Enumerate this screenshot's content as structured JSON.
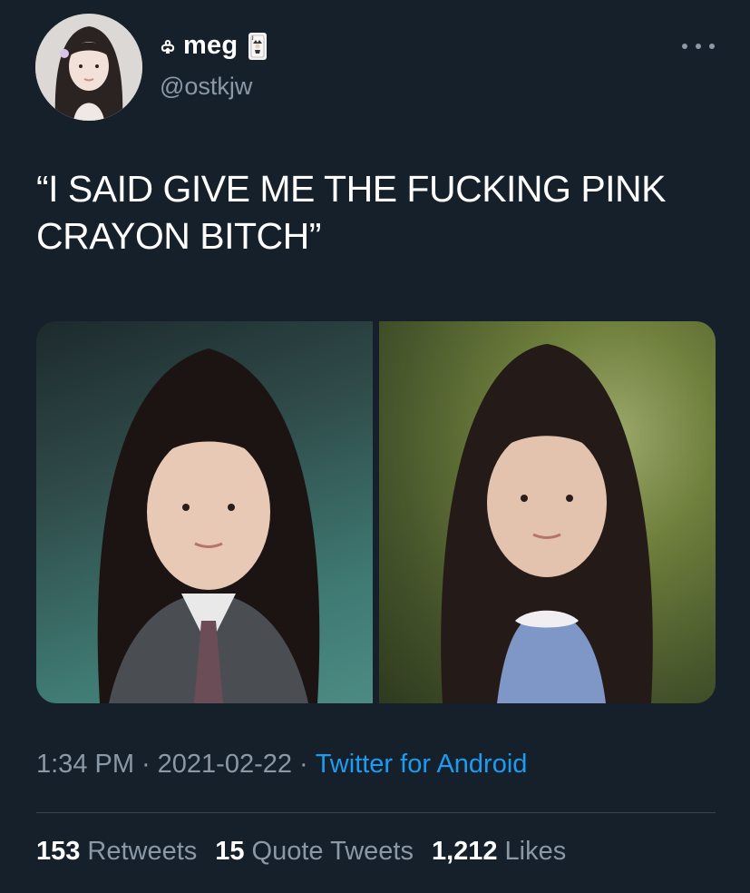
{
  "user": {
    "display_name": "meg",
    "handle": "@ostkjw",
    "name_prefix_icon": "club-outline-icon",
    "name_suffix_icon": "joker-card-icon"
  },
  "tweet": {
    "text": "“I SAID GIVE ME THE FUCKING PINK\nCRAYON BITCH”"
  },
  "media": {
    "left_photo": "portrait-photo-school-uniform",
    "right_photo": "portrait-photo-outdoor"
  },
  "meta": {
    "time": "1:34 PM",
    "sep1": "·",
    "date": "2021-02-22",
    "sep2": "·",
    "source": "Twitter for Android"
  },
  "stats": {
    "retweets_count": "153",
    "retweets_label": "Retweets",
    "quotes_count": "15",
    "quotes_label": "Quote Tweets",
    "likes_count": "1,212",
    "likes_label": "Likes"
  },
  "colors": {
    "background": "#15202b",
    "text": "#ffffff",
    "secondary": "#8b98a5",
    "link": "#1d9bf0",
    "divider": "#38444d"
  }
}
